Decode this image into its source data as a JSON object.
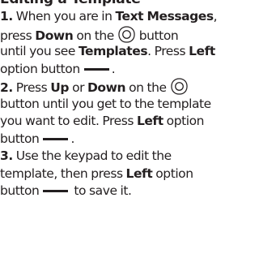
{
  "heading": "Editing a Template",
  "steps": [
    {
      "number": "1.",
      "lines": [
        [
          "When you are in ",
          "Text Messages",
          ","
        ],
        [
          "press ",
          "Down",
          " on the ",
          "button"
        ],
        [
          "until you see ",
          "Templates",
          ". Press ",
          "Left"
        ],
        [
          "option button",
          "."
        ]
      ]
    },
    {
      "number": "2.",
      "lines": [
        [
          "Press ",
          "Up",
          " or ",
          "Down",
          " on the"
        ],
        [
          "button until you get to the template"
        ],
        [
          "you want to edit. Press ",
          "Left",
          " option"
        ],
        [
          "button",
          "."
        ]
      ]
    },
    {
      "number": "3.",
      "lines": [
        [
          "Use the keypad to edit the"
        ],
        [
          "template, then press ",
          "Left",
          " option"
        ],
        [
          "button",
          " to save it."
        ]
      ]
    }
  ],
  "icons": {
    "nav": "navigation-key-icon",
    "option": "option-button-dash-icon"
  }
}
